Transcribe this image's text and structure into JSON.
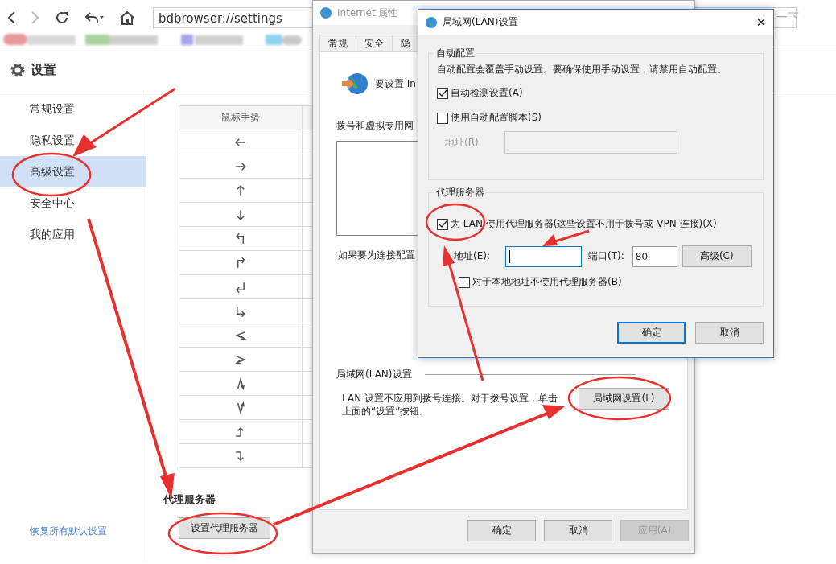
{
  "browser": {
    "address": "bdbrowser://settings",
    "search_hint": "一下"
  },
  "settings": {
    "title": "设置",
    "sidebar": [
      {
        "label": "常规设置",
        "selected": false
      },
      {
        "label": "隐私设置",
        "selected": false
      },
      {
        "label": "高级设置",
        "selected": true
      },
      {
        "label": "安全中心",
        "selected": false
      },
      {
        "label": "我的应用",
        "selected": false
      }
    ],
    "restore_link": "恢复所有默认设置",
    "gestures": {
      "header": "鼠标手势",
      "rows": [
        {
          "kind": "left"
        },
        {
          "kind": "right"
        },
        {
          "kind": "up"
        },
        {
          "kind": "down"
        },
        {
          "kind": "up-left"
        },
        {
          "kind": "up-right"
        },
        {
          "kind": "down-left"
        },
        {
          "kind": "down-right"
        },
        {
          "kind": "left-right"
        },
        {
          "kind": "right-left"
        },
        {
          "kind": "up-down"
        },
        {
          "kind": "down-up"
        },
        {
          "kind": "right-up"
        },
        {
          "kind": "right-down"
        }
      ]
    },
    "proxy": {
      "heading": "代理服务器",
      "button": "设置代理服务器"
    }
  },
  "internet_dialog": {
    "title": "Internet 属性",
    "tabs": [
      {
        "label": "常规",
        "selected": false
      },
      {
        "label": "安全",
        "selected": false
      },
      {
        "label": "隐",
        "selected": false
      }
    ],
    "intro": "要设置 In",
    "dialup_label": "拨号和虚拟专用网",
    "config_text": "如果要为连接配置",
    "lan_section": "局域网(LAN)设置",
    "lan_note": [
      "LAN 设置不应用到拨号连接。对于拨号设置，单击",
      "上面的“设置”按钮。"
    ],
    "lan_button": "局域网设置(L)",
    "buttons": [
      {
        "label": "确定",
        "disabled": false
      },
      {
        "label": "取消",
        "disabled": false
      },
      {
        "label": "应用(A)",
        "disabled": true
      }
    ]
  },
  "lan_dialog": {
    "title": "局域网(LAN)设置",
    "close": "✕",
    "auto": {
      "legend": "自动配置",
      "note": "自动配置会覆盖手动设置。要确保使用手动设置，请禁用自动配置。",
      "options": [
        {
          "label": "自动检测设置(A)",
          "checked": true
        },
        {
          "label": "使用自动配置脚本(S)",
          "checked": false
        }
      ],
      "address_label": "地址(R)",
      "address_disabled": true
    },
    "proxy": {
      "legend": "代理服务器",
      "use_proxy": {
        "label": "为 LAN 使用代理服务器(这些设置不用于拨号或 VPN 连接)(X)",
        "checked": true
      },
      "address_label": "地址(E):",
      "address_focused": true,
      "port_label": "端口(T):",
      "port": "80",
      "advanced": "高级(C)",
      "bypass": {
        "label": "对于本地地址不使用代理服务器(B)",
        "checked": false
      }
    },
    "buttons": [
      {
        "label": "确定",
        "default": true
      },
      {
        "label": "取消",
        "default": false
      }
    ]
  }
}
